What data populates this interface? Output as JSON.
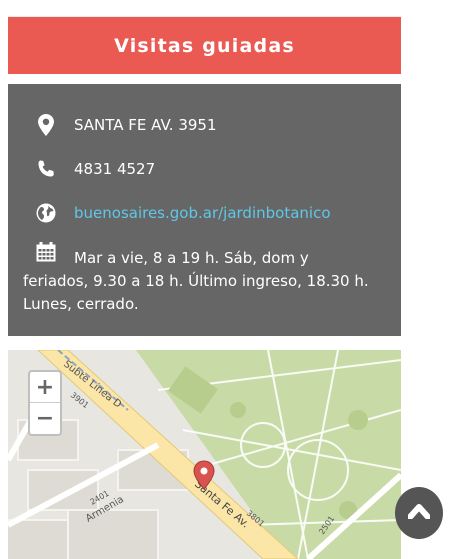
{
  "section": {
    "title": "Visitas guiadas"
  },
  "info": {
    "address": "SANTA FE AV. 3951",
    "phone": "4831 4527",
    "website": "buenosaires.gob.ar/jardinbotanico",
    "hours": "Mar a vie, 8 a 19 h. Sáb, dom y feriados, 9.30 a 18 h. Último ingreso, 18.30 h. Lunes, cerrado.",
    "icons": [
      "map-marker-icon",
      "phone-icon",
      "globe-icon",
      "calendar-icon"
    ]
  },
  "map": {
    "zoom_in": "+",
    "zoom_out": "−",
    "labels": {
      "subte": "Subte Línea D",
      "avenue": "Santa Fe Av.",
      "armenia": "Armenia",
      "num_3901": "3901",
      "num_2401": "2401",
      "num_3801": "3801",
      "num_2501": "2501"
    }
  },
  "colors": {
    "title_bg": "#ea5a53",
    "info_bg": "#666666",
    "link": "#5fc7e8",
    "park": "#c8dba6",
    "road": "#fbe6a7",
    "pin": "#d9534f"
  }
}
